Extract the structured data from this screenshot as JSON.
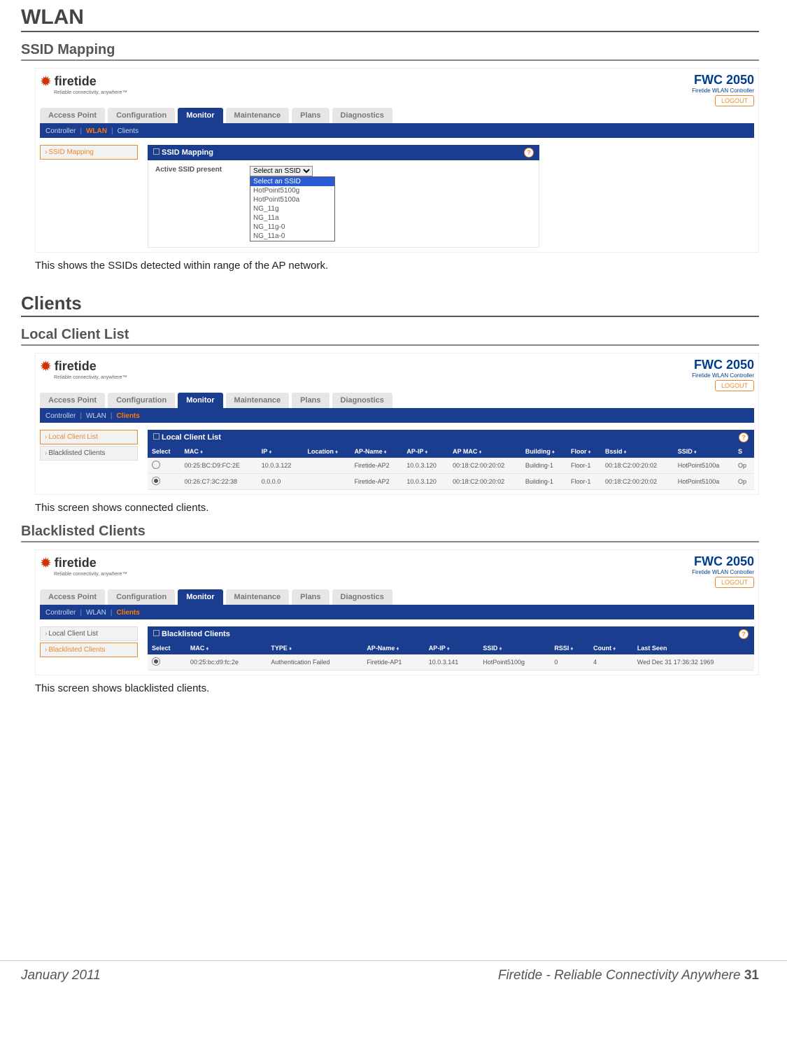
{
  "doc": {
    "h1": "WLAN",
    "h2_ssid": "SSID Mapping",
    "cap_ssid": "This shows the SSIDs detected within range of the AP network.",
    "h1b": "Clients",
    "h2_local": "Local Client List",
    "cap_local": "This screen shows connected clients.",
    "h2_black": "Blacklisted Clients",
    "cap_black": "This screen shows blacklisted clients."
  },
  "chrome": {
    "brand": "firetide",
    "tagline": "Reliable connectivity, anywhere™",
    "product": "FWC 2050",
    "product_sub": "Firetide WLAN Controller",
    "logout": "LOGOUT",
    "tabs": [
      "Access Point",
      "Configuration",
      "Monitor",
      "Maintenance",
      "Plans",
      "Diagnostics"
    ],
    "sub_controller": "Controller",
    "sub_wlan": "WLAN",
    "sub_clients": "Clients",
    "help": "?"
  },
  "ssid": {
    "side_item": "SSID Mapping",
    "panel_title": "SSID Mapping",
    "field_label": "Active SSID present",
    "select_placeholder": "Select an SSID",
    "options": [
      "Select an SSID",
      "HotPoint5100g",
      "HotPoint5100a",
      "NG_11g",
      "NG_11a",
      "NG_11g-0",
      "NG_11a-0"
    ]
  },
  "local": {
    "side_items": [
      "Local Client List",
      "Blacklisted Clients"
    ],
    "panel_title": "Local Client List",
    "cols": [
      "Select",
      "MAC",
      "IP",
      "Location",
      "AP-Name",
      "AP-IP",
      "AP MAC",
      "Building",
      "Floor",
      "Bssid",
      "SSID",
      "S"
    ],
    "rows": [
      [
        "00:25:BC:D9:FC:2E",
        "10.0.3.122",
        "",
        "Firetide-AP2",
        "10.0.3.120",
        "00:18:C2:00:20:02",
        "Building-1",
        "Floor-1",
        "00:18:C2:00:20:02",
        "HotPoint5100a",
        "Op"
      ],
      [
        "00:26:C7:3C:22:38",
        "0.0.0.0",
        "",
        "Firetide-AP2",
        "10.0.3.120",
        "00:18:C2:00:20:02",
        "Building-1",
        "Floor-1",
        "00:18:C2:00:20:02",
        "HotPoint5100a",
        "Op"
      ]
    ]
  },
  "black": {
    "side_items": [
      "Local Client List",
      "Blacklisted Clients"
    ],
    "panel_title": "Blacklisted Clients",
    "cols": [
      "Select",
      "MAC",
      "TYPE",
      "AP-Name",
      "AP-IP",
      "SSID",
      "RSSI",
      "Count",
      "Last Seen"
    ],
    "rows": [
      [
        "00:25:bc:d9:fc:2e",
        "Authentication Failed",
        "Firetide-AP1",
        "10.0.3.141",
        "HotPoint5100g",
        "0",
        "4",
        "Wed Dec 31 17:36:32 1969"
      ]
    ]
  },
  "footer": {
    "left": "January 2011",
    "right_text": "Firetide - Reliable Connectivity Anywhere ",
    "page": "31"
  }
}
